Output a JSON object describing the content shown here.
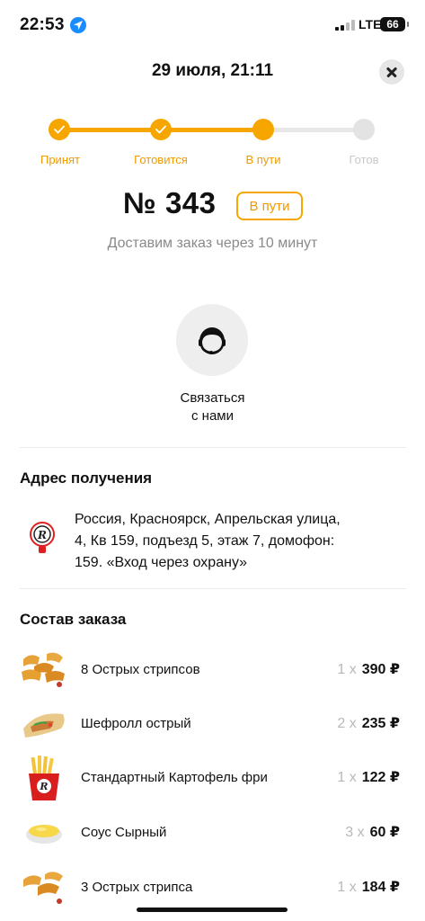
{
  "status_bar": {
    "time": "22:53",
    "network": "LTE",
    "battery": "66"
  },
  "header": {
    "title": "29 июля, 21:11"
  },
  "progress": {
    "steps": [
      {
        "label": "Принят",
        "state": "done"
      },
      {
        "label": "Готовится",
        "state": "done"
      },
      {
        "label": "В пути",
        "state": "current"
      },
      {
        "label": "Готов",
        "state": "pending"
      }
    ]
  },
  "order": {
    "number": "№ 343",
    "status_badge": "В пути",
    "eta_text": "Доставим заказ через 10 минут"
  },
  "contact": {
    "label_line1": "Связаться",
    "label_line2": "с нами"
  },
  "address": {
    "title": "Адрес получения",
    "line1": "Россия, Красноярск, Апрельская улица,",
    "line2": "4, Кв 159, подъезд 5, этаж 7, домофон:",
    "line3": "159. «Вход через охрану»"
  },
  "order_items": {
    "title": "Состав заказа",
    "items": [
      {
        "name": "8 Острых стрипсов",
        "qty": "1 x",
        "price": "390 ₽",
        "icon": "strips-icon"
      },
      {
        "name": "Шефролл острый",
        "qty": "2 x",
        "price": "235 ₽",
        "icon": "roll-icon"
      },
      {
        "name": "Стандартный Картофель фри",
        "qty": "1 x",
        "price": "122 ₽",
        "icon": "fries-icon"
      },
      {
        "name": "Соус Сырный",
        "qty": "3 x",
        "price": "60 ₽",
        "icon": "sauce-icon"
      },
      {
        "name": "3 Острых стрипса",
        "qty": "1 x",
        "price": "184 ₽",
        "icon": "strips-icon"
      }
    ]
  },
  "colors": {
    "accent": "#f7a600",
    "accent_text": "#f09a00",
    "muted": "#8a8a8a",
    "inactive": "#e3e3e3"
  }
}
